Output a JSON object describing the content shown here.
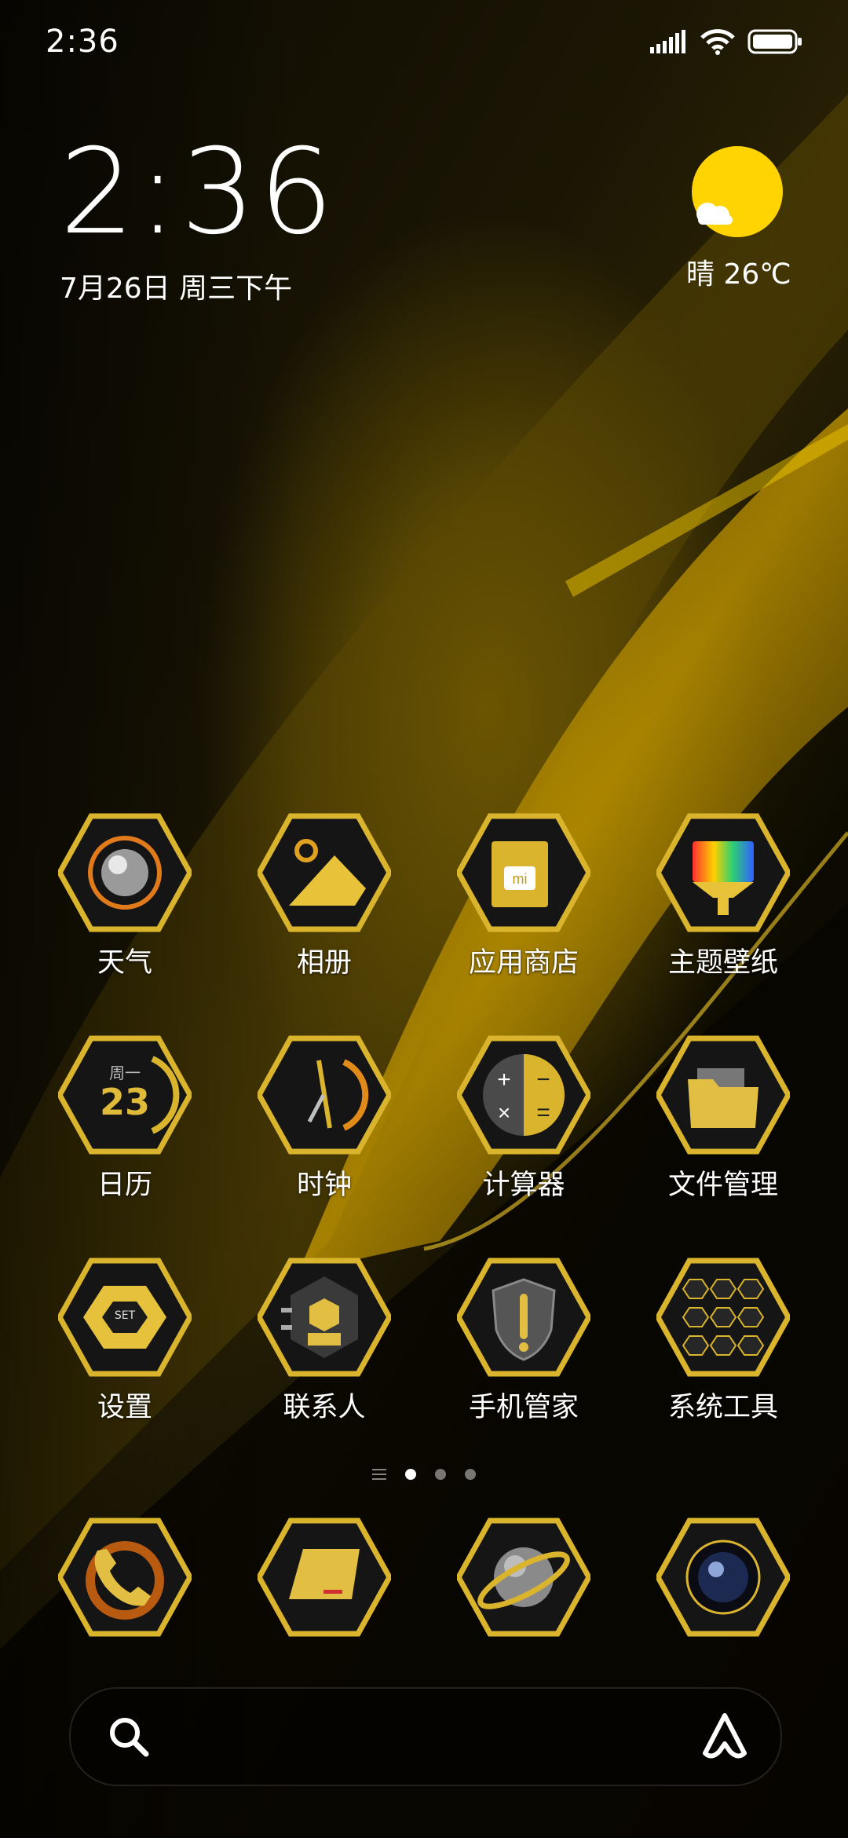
{
  "status_bar": {
    "time": "2:36",
    "icons": [
      "signal-icon",
      "wifi-icon",
      "battery-icon"
    ]
  },
  "clock_widget": {
    "time": "2:36",
    "date": "7月26日 周三下午"
  },
  "weather_widget": {
    "text": "晴 26℃",
    "icon": "sun-cloud-icon"
  },
  "apps": [
    [
      {
        "label": "天气",
        "icon": "weather-orb-icon"
      },
      {
        "label": "相册",
        "icon": "gallery-icon"
      },
      {
        "label": "应用商店",
        "icon": "mi-store-icon"
      },
      {
        "label": "主题壁纸",
        "icon": "theme-brush-icon"
      }
    ],
    [
      {
        "label": "日历",
        "icon": "calendar-icon",
        "inner_text": "23",
        "inner_sub": "周一"
      },
      {
        "label": "时钟",
        "icon": "clock-icon"
      },
      {
        "label": "计算器",
        "icon": "calculator-icon"
      },
      {
        "label": "文件管理",
        "icon": "folder-icon"
      }
    ],
    [
      {
        "label": "设置",
        "icon": "settings-icon",
        "inner_text": "SET"
      },
      {
        "label": "联系人",
        "icon": "contacts-icon"
      },
      {
        "label": "手机管家",
        "icon": "security-shield-icon"
      },
      {
        "label": "系统工具",
        "icon": "system-tools-folder-icon"
      }
    ]
  ],
  "page_indicator": {
    "pages": 3,
    "active_index": 0
  },
  "dock": [
    {
      "icon": "phone-icon"
    },
    {
      "icon": "messages-icon"
    },
    {
      "icon": "browser-planet-icon"
    },
    {
      "icon": "camera-icon"
    }
  ],
  "colors": {
    "gold": "#d9b42c",
    "gold_light": "#f3d46a",
    "hex_dark": "#151515",
    "sun": "#ffd400"
  }
}
